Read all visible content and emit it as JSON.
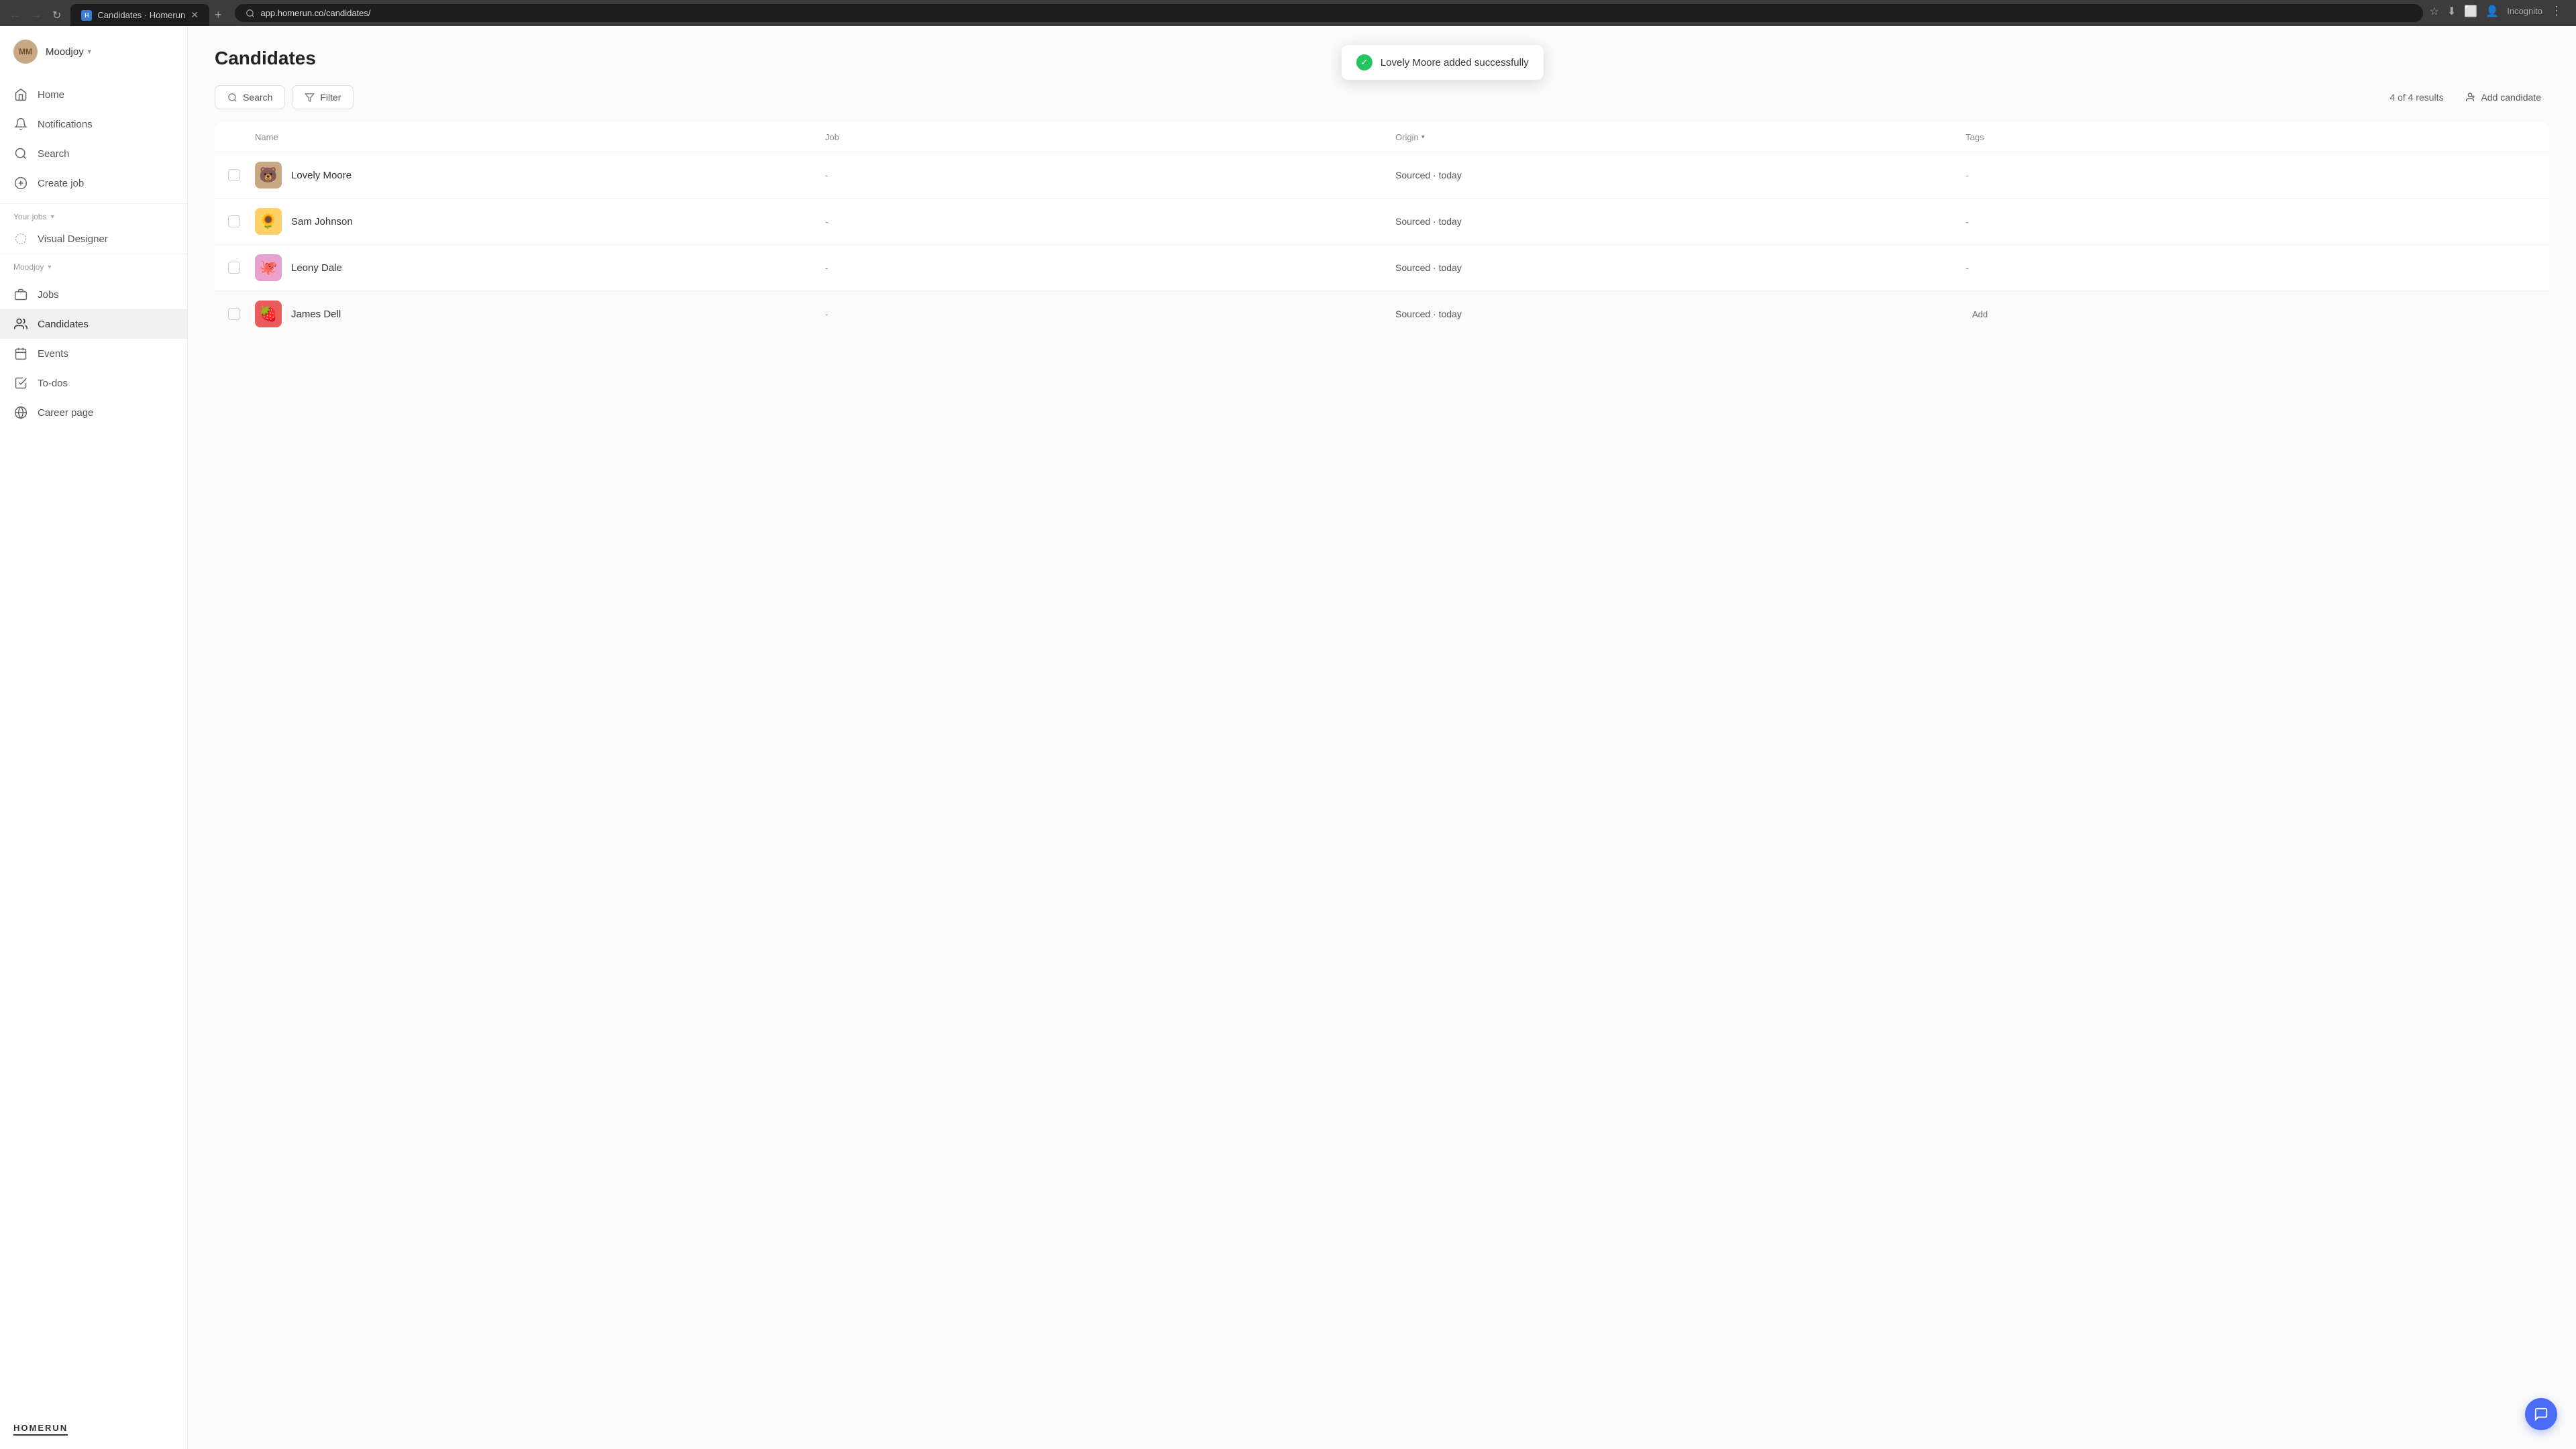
{
  "browser": {
    "tab_title": "Candidates · Homerun",
    "tab_new": "+",
    "url": "app.homerun.co/candidates/",
    "incognito_label": "Incognito"
  },
  "sidebar": {
    "user_initials": "MM",
    "user_name": "Moodjoy",
    "nav": [
      {
        "id": "home",
        "label": "Home",
        "icon": "home"
      },
      {
        "id": "notifications",
        "label": "Notifications",
        "icon": "bell"
      },
      {
        "id": "search",
        "label": "Search",
        "icon": "search"
      },
      {
        "id": "create-job",
        "label": "Create job",
        "icon": "plus-circle"
      }
    ],
    "your_jobs_label": "Your jobs",
    "jobs": [
      {
        "id": "visual-designer",
        "label": "Visual Designer",
        "icon": "ring"
      }
    ],
    "moodjoy_label": "Moodjoy",
    "bottom_nav": [
      {
        "id": "jobs",
        "label": "Jobs",
        "icon": "briefcase"
      },
      {
        "id": "candidates",
        "label": "Candidates",
        "icon": "users",
        "active": true
      },
      {
        "id": "events",
        "label": "Events",
        "icon": "calendar"
      },
      {
        "id": "todos",
        "label": "To-dos",
        "icon": "check-square"
      },
      {
        "id": "career-page",
        "label": "Career page",
        "icon": "globe"
      }
    ],
    "logo_text": "HOMERUN"
  },
  "main": {
    "page_title": "Candidates",
    "toast": {
      "message": "Lovely Moore added successfully"
    },
    "toolbar": {
      "search_label": "Search",
      "filter_label": "Filter",
      "results_count": "4 of 4 results",
      "add_candidate_label": "Add candidate"
    },
    "table": {
      "columns": [
        "Name",
        "Job",
        "Origin",
        "Tags"
      ],
      "rows": [
        {
          "name": "Lovely Moore",
          "job": "-",
          "origin": "Sourced · today",
          "tags": "-",
          "avatar_emoji": "🐻",
          "avatar_class": "avatar-lovely"
        },
        {
          "name": "Sam Johnson",
          "job": "-",
          "origin": "Sourced · today",
          "tags": "-",
          "avatar_emoji": "🌻",
          "avatar_class": "avatar-sam"
        },
        {
          "name": "Leony Dale",
          "job": "-",
          "origin": "Sourced · today",
          "tags": "-",
          "avatar_emoji": "🐙",
          "avatar_class": "avatar-leony"
        },
        {
          "name": "James Dell",
          "job": "-",
          "origin": "Sourced · today",
          "tags": "Add",
          "avatar_emoji": "🍓",
          "avatar_class": "avatar-james"
        }
      ]
    }
  },
  "chat": {
    "icon": "💬"
  }
}
